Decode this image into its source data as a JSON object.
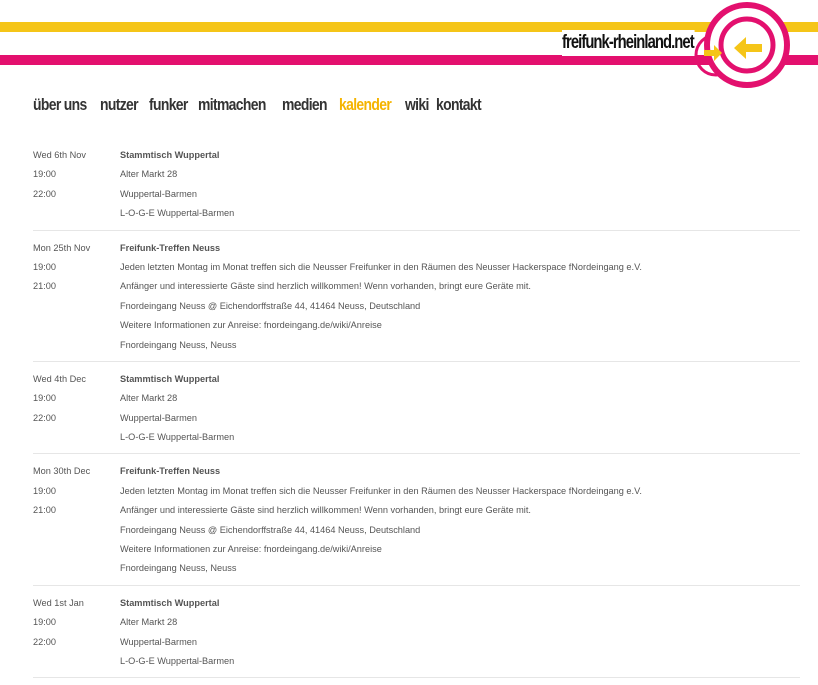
{
  "site": {
    "title": "freifunk-rheinland.net"
  },
  "nav": {
    "items": [
      {
        "label": "über uns"
      },
      {
        "label": "nutzer"
      },
      {
        "label": "funker"
      },
      {
        "label": "mitmachen"
      },
      {
        "label": "medien"
      },
      {
        "label": "kalender"
      },
      {
        "label": "wiki"
      },
      {
        "label": "kontakt"
      }
    ],
    "active": "kalender"
  },
  "colors": {
    "yellow": "#f5c518",
    "pink": "#e3106e",
    "active_nav": "#f5b400"
  },
  "events": [
    {
      "date": "Wed 6th Nov",
      "start": "19:00",
      "end": "22:00",
      "title": "Stammtisch Wuppertal",
      "lines": [
        "Alter Markt 28",
        "Wuppertal-Barmen",
        "L-O-G-E Wuppertal-Barmen"
      ]
    },
    {
      "date": "Mon 25th Nov",
      "start": "19:00",
      "end": "21:00",
      "title": "Freifunk-Treffen Neuss",
      "lines": [
        "Jeden letzten Montag im Monat treffen sich die Neusser Freifunker in den Räumen des Neusser Hackerspace fNordeingang e.V.",
        "Anfänger und interessierte Gäste sind herzlich willkommen! Wenn vorhanden, bringt eure Geräte mit.",
        "Fnordeingang Neuss @ Eichendorffstraße 44, 41464 Neuss, Deutschland",
        "Weitere Informationen zur Anreise: fnordeingang.de/wiki/Anreise",
        "Fnordeingang Neuss, Neuss"
      ]
    },
    {
      "date": "Wed 4th Dec",
      "start": "19:00",
      "end": "22:00",
      "title": "Stammtisch Wuppertal",
      "lines": [
        "Alter Markt 28",
        "Wuppertal-Barmen",
        "L-O-G-E Wuppertal-Barmen"
      ]
    },
    {
      "date": "Mon 30th Dec",
      "start": "19:00",
      "end": "21:00",
      "title": "Freifunk-Treffen Neuss",
      "lines": [
        "Jeden letzten Montag im Monat treffen sich die Neusser Freifunker in den Räumen des Neusser Hackerspace fNordeingang e.V.",
        "Anfänger und interessierte Gäste sind herzlich willkommen! Wenn vorhanden, bringt eure Geräte mit.",
        "Fnordeingang Neuss @ Eichendorffstraße 44, 41464 Neuss, Deutschland",
        "Weitere Informationen zur Anreise: fnordeingang.de/wiki/Anreise",
        "Fnordeingang Neuss, Neuss"
      ]
    },
    {
      "date": "Wed 1st Jan",
      "start": "19:00",
      "end": "22:00",
      "title": "Stammtisch Wuppertal",
      "lines": [
        "Alter Markt 28",
        "Wuppertal-Barmen",
        "L-O-G-E Wuppertal-Barmen"
      ]
    }
  ]
}
